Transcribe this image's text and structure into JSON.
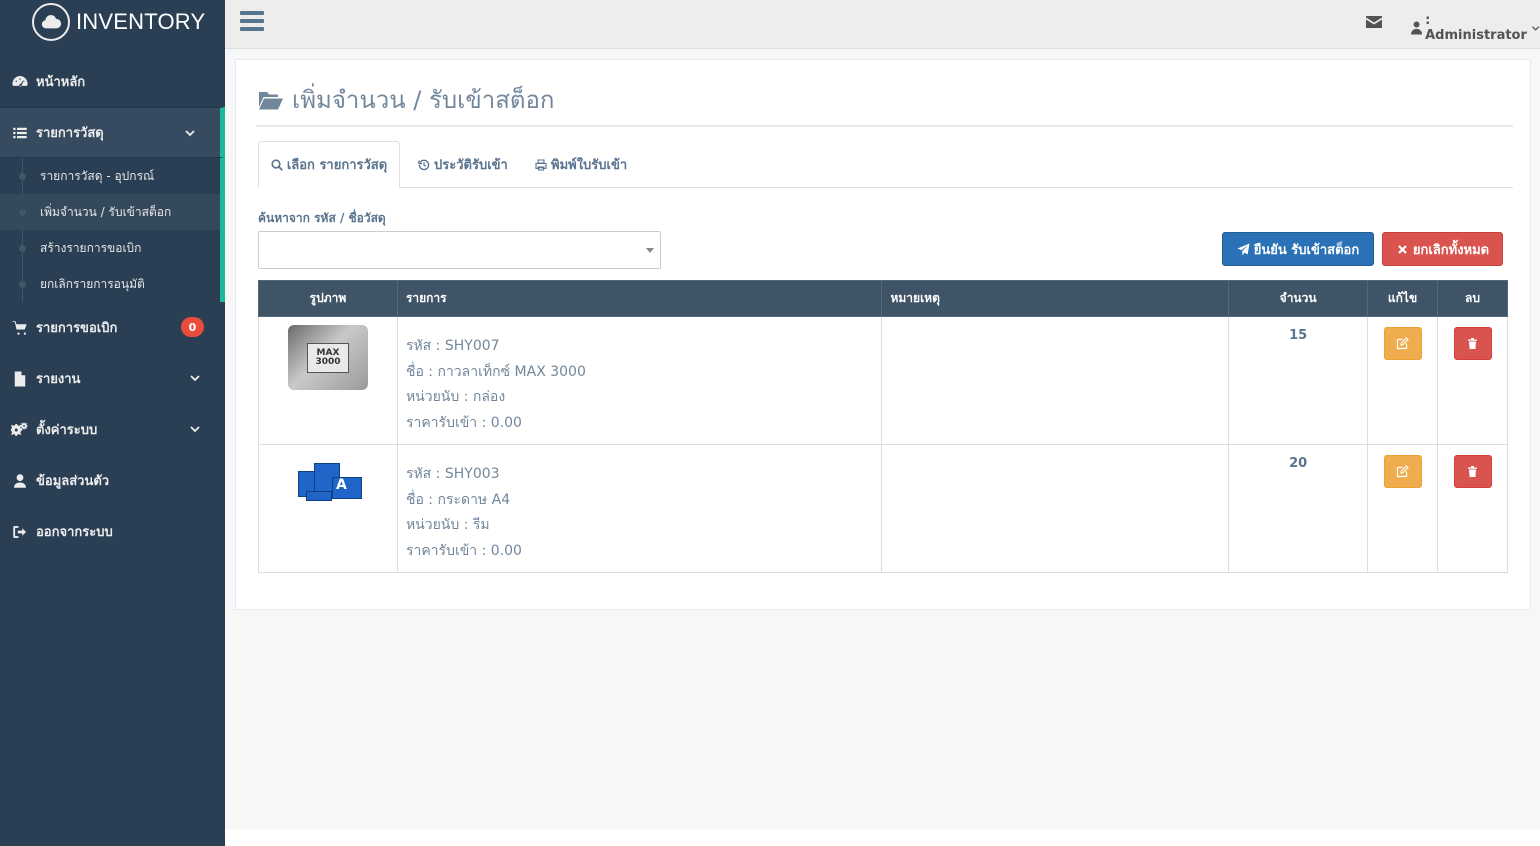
{
  "brand": {
    "title": "INVENTORY"
  },
  "sidebar": {
    "home": "หน้าหลัก",
    "materials": "รายการวัสดุ",
    "sub_items": [
      "รายการวัสดุ - อุปกรณ์",
      "เพิ่มจำนวน / รับเข้าสต็อก",
      "สร้างรายการขอเบิก",
      "ยกเลิกรายการอนุมัติ"
    ],
    "requests": "รายการขอเบิก",
    "requests_badge": "0",
    "reports": "รายงาน",
    "settings": "ตั้งค่าระบบ",
    "profile": "ข้อมูลส่วนตัว",
    "logout": "ออกจากระบบ"
  },
  "topbar": {
    "user": ": Administrator"
  },
  "page": {
    "title": "เพิ่มจำนวน / รับเข้าสต็อก"
  },
  "tabs": [
    {
      "label": "เลือก รายการวัสดุ",
      "active": true
    },
    {
      "label": "ประวัติรับเข้า",
      "active": false
    },
    {
      "label": "พิมพ์ใบรับเข้า",
      "active": false
    }
  ],
  "search": {
    "label": "ค้นหาจาก รหัส / ชื่อวัสดุ",
    "value": ""
  },
  "buttons": {
    "confirm": "ยืนยัน รับเข้าสต็อก",
    "cancel_all": "ยกเลิกทั้งหมด"
  },
  "table": {
    "headers": [
      "รูปภาพ",
      "รายการ",
      "หมายเหตุ",
      "จำนวน",
      "แก้ไข",
      "ลบ"
    ],
    "rows": [
      {
        "code": "รหัส : SHY007",
        "name": "ชื่อ : กาวลาเท็กซ์ MAX 3000",
        "unit": "หน่วยนับ : กล่อง",
        "price": "ราคารับเข้า : 0.00",
        "note": "",
        "qty": "15",
        "image_label": "MAX 3000"
      },
      {
        "code": "รหัส : SHY003",
        "name": "ชื่อ : กระดาษ A4",
        "unit": "หน่วยนับ : รีม",
        "price": "ราคารับเข้า : 0.00",
        "note": "",
        "qty": "20",
        "image_label": "A"
      }
    ]
  },
  "colors": {
    "sidebar_bg": "#2a3f54",
    "accent": "#1abb9c",
    "primary": "#2a72b5",
    "danger": "#d9534f",
    "warning": "#f0ad4e",
    "table_header": "#405467"
  },
  "icons": {
    "brand": "cloud-icon",
    "home": "dashboard-icon",
    "materials": "list-icon",
    "requests": "cart-icon",
    "reports": "file-icon",
    "settings": "gears-icon",
    "profile": "user-icon",
    "logout": "sign-out-icon",
    "mail": "envelope-icon",
    "title": "folder-open-icon"
  }
}
